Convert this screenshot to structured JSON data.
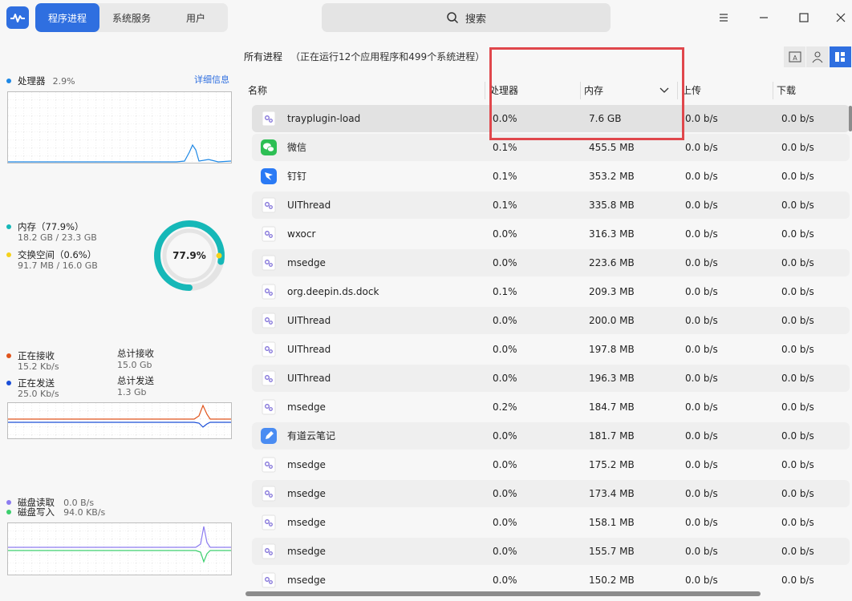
{
  "header": {
    "tabs": [
      {
        "label": "程序进程",
        "active": true
      },
      {
        "label": "系统服务",
        "active": false
      },
      {
        "label": "用户",
        "active": false
      }
    ],
    "search_label": "搜索"
  },
  "sidebar": {
    "cpu": {
      "label": "处理器",
      "value": "2.9%",
      "detail_link": "详细信息",
      "color": "#1e88e5"
    },
    "memory": {
      "label": "内存（77.9%）",
      "usage": "18.2 GB / 23.3 GB",
      "color": "#16b8b8",
      "swap_label": "交换空间（0.6%）",
      "swap_usage": "91.7 MB / 16.0 GB",
      "swap_color": "#f5d21c",
      "gauge_value": "77.9%",
      "gauge_fraction": 0.779
    },
    "network": {
      "recv_label": "正在接收",
      "recv_value": "15.2 Kb/s",
      "recv_color": "#e0541c",
      "recv_total_label": "总计接收",
      "recv_total": "15.0 Gb",
      "send_label": "正在发送",
      "send_value": "25.0 Kb/s",
      "send_color": "#1b4fd8",
      "send_total_label": "总计发送",
      "send_total": "1.3 Gb"
    },
    "disk": {
      "read_label": "磁盘读取",
      "read_value": "0.0 B/s",
      "read_color": "#8c7cf0",
      "write_label": "磁盘写入",
      "write_value": "94.0 KB/s",
      "write_color": "#3ccf6e"
    }
  },
  "main": {
    "title": "所有进程",
    "note": "（正在运行12个应用程序和499个系统进程）",
    "columns": [
      "名称",
      "处理器",
      "内存",
      "上传",
      "下载"
    ],
    "rows": [
      {
        "name": "trayplugin-load",
        "icon": "gear-icon",
        "cpu": "0.0%",
        "mem": "7.6  GB",
        "up": "0.0  b/s",
        "down": "0.0  b/s"
      },
      {
        "name": "微信",
        "icon": "wechat-icon",
        "cpu": "0.1%",
        "mem": "455.5  MB",
        "up": "0.0  b/s",
        "down": "0.0  b/s"
      },
      {
        "name": "钉钉",
        "icon": "dingtalk-icon",
        "cpu": "0.1%",
        "mem": "353.2  MB",
        "up": "0.0  b/s",
        "down": "0.0  b/s"
      },
      {
        "name": "UIThread",
        "icon": "gear-icon",
        "cpu": "0.1%",
        "mem": "335.8  MB",
        "up": "0.0  b/s",
        "down": "0.0  b/s"
      },
      {
        "name": "wxocr",
        "icon": "gear-icon",
        "cpu": "0.0%",
        "mem": "316.3  MB",
        "up": "0.0  b/s",
        "down": "0.0  b/s"
      },
      {
        "name": "msedge",
        "icon": "gear-icon",
        "cpu": "0.0%",
        "mem": "223.6  MB",
        "up": "0.0  b/s",
        "down": "0.0  b/s"
      },
      {
        "name": "org.deepin.ds.dock",
        "icon": "gear-icon",
        "cpu": "0.1%",
        "mem": "209.3  MB",
        "up": "0.0  b/s",
        "down": "0.0  b/s"
      },
      {
        "name": "UIThread",
        "icon": "gear-icon",
        "cpu": "0.0%",
        "mem": "200.0  MB",
        "up": "0.0  b/s",
        "down": "0.0  b/s"
      },
      {
        "name": "UIThread",
        "icon": "gear-icon",
        "cpu": "0.0%",
        "mem": "197.8  MB",
        "up": "0.0  b/s",
        "down": "0.0  b/s"
      },
      {
        "name": "UIThread",
        "icon": "gear-icon",
        "cpu": "0.0%",
        "mem": "196.3  MB",
        "up": "0.0  b/s",
        "down": "0.0  b/s"
      },
      {
        "name": "msedge",
        "icon": "gear-icon",
        "cpu": "0.2%",
        "mem": "184.7  MB",
        "up": "0.0  b/s",
        "down": "0.0  b/s"
      },
      {
        "name": "有道云笔记",
        "icon": "youdao-note-icon",
        "cpu": "0.0%",
        "mem": "181.7  MB",
        "up": "0.0  b/s",
        "down": "0.0  b/s"
      },
      {
        "name": "msedge",
        "icon": "gear-icon",
        "cpu": "0.0%",
        "mem": "175.2  MB",
        "up": "0.0  b/s",
        "down": "0.0  b/s"
      },
      {
        "name": "msedge",
        "icon": "gear-icon",
        "cpu": "0.0%",
        "mem": "173.4  MB",
        "up": "0.0  b/s",
        "down": "0.0  b/s"
      },
      {
        "name": "msedge",
        "icon": "gear-icon",
        "cpu": "0.0%",
        "mem": "158.1  MB",
        "up": "0.0  b/s",
        "down": "0.0  b/s"
      },
      {
        "name": "msedge",
        "icon": "gear-icon",
        "cpu": "0.0%",
        "mem": "155.7  MB",
        "up": "0.0  b/s",
        "down": "0.0  b/s"
      },
      {
        "name": "msedge",
        "icon": "gear-icon",
        "cpu": "0.0%",
        "mem": "150.2  MB",
        "up": "0.0  b/s",
        "down": "0.0  b/s"
      }
    ]
  }
}
